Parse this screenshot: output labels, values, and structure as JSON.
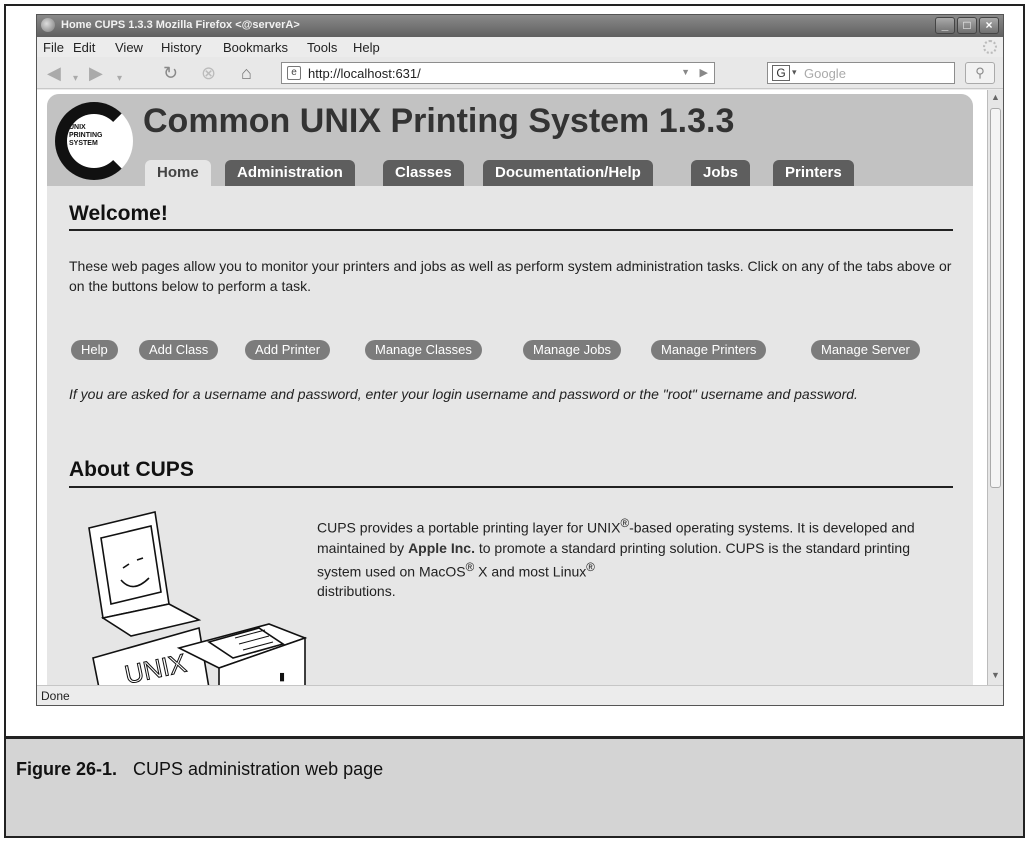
{
  "window": {
    "title": "Home  CUPS 1.3.3  Mozilla Firefox <@serverA>",
    "controls": [
      "_",
      "□",
      "×"
    ]
  },
  "menu": [
    "File",
    "Edit",
    "View",
    "History",
    "Bookmarks",
    "Tools",
    "Help"
  ],
  "toolbar": {
    "url": "http://localhost:631/",
    "search_engine": "G",
    "search_placeholder": "Google",
    "icons": [
      "back-arrow-icon",
      "forward-arrow-icon",
      "reload-icon",
      "stop-icon",
      "home-icon"
    ]
  },
  "header": {
    "logo_text": "UNIX\nPRINTING\nSYSTEM",
    "title": "Common UNIX Printing System 1.3.3",
    "tabs": [
      "Home",
      "Administration",
      "Classes",
      "Documentation/Help",
      "Jobs",
      "Printers"
    ],
    "active_tab": "Home"
  },
  "welcome": {
    "heading": "Welcome!",
    "intro": "These web pages allow you to monitor your printers and jobs as well as perform system administration tasks. Click on any of the tabs above or on the buttons below to perform a task.",
    "buttons": [
      "Help",
      "Add Class",
      "Add Printer",
      "Manage Classes",
      "Manage Jobs",
      "Manage Printers",
      "Manage Server"
    ],
    "note": "If you are asked for a username and password, enter your login username and password or the \"root\" username and password."
  },
  "about": {
    "heading": "About CUPS",
    "text_1": "CUPS provides a portable printing layer for UNIX",
    "reg": "®",
    "text_2": "-based operating systems. It is developed and maintained by ",
    "company": "Apple Inc.",
    "text_3": " to promote a standard printing solution. CUPS is the standard printing system used on MacOS",
    "text_4": " X and most Linux",
    "text_5": " distributions.",
    "illustration_label": "UNIX"
  },
  "status": "Done",
  "caption": {
    "number": "Figure 26-1.",
    "text": "CUPS administration web page"
  }
}
